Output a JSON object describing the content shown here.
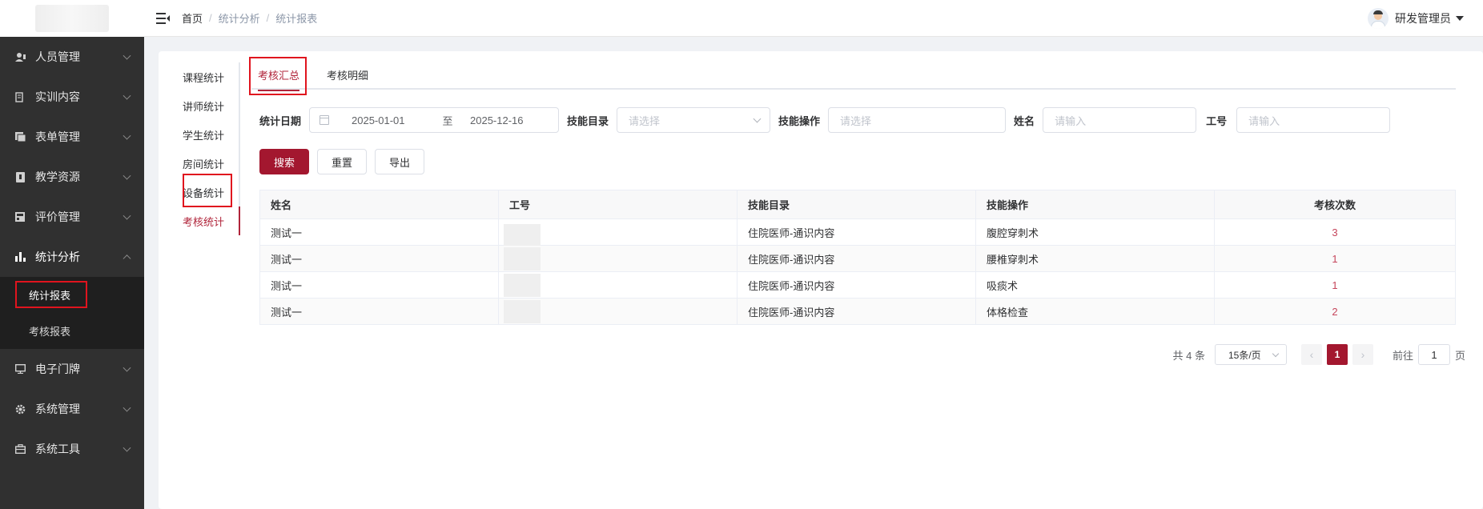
{
  "sidebar": {
    "items": [
      {
        "label": "人员管理",
        "icon": "user-icon"
      },
      {
        "label": "实训内容",
        "icon": "doc-icon"
      },
      {
        "label": "表单管理",
        "icon": "form-icon"
      },
      {
        "label": "教学资源",
        "icon": "book-icon"
      },
      {
        "label": "评价管理",
        "icon": "evaluation-icon"
      },
      {
        "label": "统计分析",
        "icon": "bar-chart-icon"
      },
      {
        "label": "电子门牌",
        "icon": "monitor-icon"
      },
      {
        "label": "系统管理",
        "icon": "gear-icon"
      },
      {
        "label": "系统工具",
        "icon": "toolbox-icon"
      }
    ],
    "submenu": [
      {
        "label": "统计报表"
      },
      {
        "label": "考核报表"
      }
    ]
  },
  "header": {
    "breadcrumb": [
      "首页",
      "统计分析",
      "统计报表"
    ],
    "separator": "/",
    "user_name": "研发管理员"
  },
  "left_nav": [
    "课程统计",
    "讲师统计",
    "学生统计",
    "房间统计",
    "设备统计",
    "考核统计"
  ],
  "tabs": [
    "考核汇总",
    "考核明细"
  ],
  "filters": {
    "date_label": "统计日期",
    "date_start": "2025-01-01",
    "date_to": "至",
    "date_end": "2025-12-16",
    "skill_catalog_label": "技能目录",
    "skill_catalog_placeholder": "请选择",
    "skill_op_label": "技能操作",
    "skill_op_placeholder": "请选择",
    "name_label": "姓名",
    "name_placeholder": "请输入",
    "job_no_label": "工号",
    "job_no_placeholder": "请输入"
  },
  "buttons": {
    "search": "搜索",
    "reset": "重置",
    "export": "导出"
  },
  "table": {
    "columns": [
      "姓名",
      "工号",
      "技能目录",
      "技能操作",
      "考核次数"
    ],
    "rows": [
      {
        "name": "测试一",
        "job_no": "",
        "catalog": "住院医师-通识内容",
        "operation": "腹腔穿刺术",
        "count": "3"
      },
      {
        "name": "测试一",
        "job_no": "",
        "catalog": "住院医师-通识内容",
        "operation": "腰椎穿刺术",
        "count": "1"
      },
      {
        "name": "测试一",
        "job_no": "",
        "catalog": "住院医师-通识内容",
        "operation": "吸痰术",
        "count": "1"
      },
      {
        "name": "测试一",
        "job_no": "",
        "catalog": "住院医师-通识内容",
        "operation": "体格检查",
        "count": "2"
      }
    ]
  },
  "pagination": {
    "total": "共 4 条",
    "page_size": "15条/页",
    "prev": "‹",
    "current_page": "1",
    "next": "›",
    "goto_label": "前往",
    "goto_value": "1",
    "page_suffix": "页"
  },
  "colors": {
    "accent": "#a3172f",
    "sidebar_bg": "#303030",
    "highlight_box": "#e0141e"
  }
}
